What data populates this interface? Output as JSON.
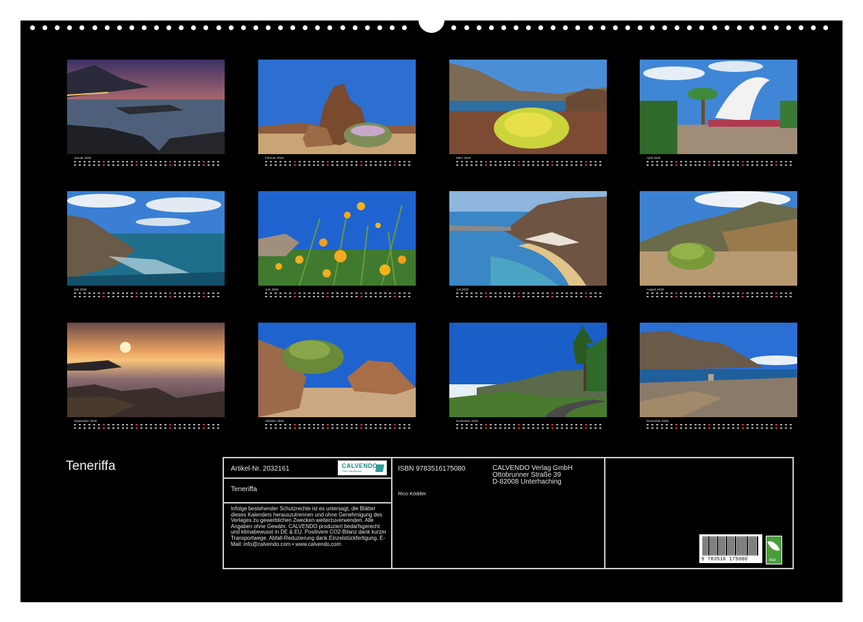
{
  "calendar": {
    "title": "Teneriffa",
    "months": [
      {
        "label": "Januar 2026",
        "scene": "coast-dusk"
      },
      {
        "label": "Februar 2026",
        "scene": "rock-desert"
      },
      {
        "label": "März 2026",
        "scene": "yellow-flowers-coast"
      },
      {
        "label": "April 2026",
        "scene": "auditorium-palms"
      },
      {
        "label": "Mai 2026",
        "scene": "rocky-ocean"
      },
      {
        "label": "Juni 2026",
        "scene": "poppies"
      },
      {
        "label": "Juli 2026",
        "scene": "beach-bay"
      },
      {
        "label": "August 2026",
        "scene": "mountain-shrub"
      },
      {
        "label": "September 2026",
        "scene": "sunset-sea"
      },
      {
        "label": "Oktober 2026",
        "scene": "boulders-shrub"
      },
      {
        "label": "November 2026",
        "scene": "mountain-road"
      },
      {
        "label": "Dezember 2026",
        "scene": "cliff-promenade"
      }
    ]
  },
  "info": {
    "article_no": "Artikel-Nr. 2032161",
    "logo_text": "CALVENDO",
    "logo_sub": "Gute Kalendertage",
    "title": "Teneriffa",
    "isbn": "ISBN 9783516175080",
    "author": "Rico Ködder",
    "publisher_name": "CALVENDO Verlag GmbH",
    "publisher_street": "Ottobrunner Straße 39",
    "publisher_city": "D-82008 Unterhaching",
    "legal_text": "Infolge bestehender Schutzrechte ist es untersagt, die Blätter dieses Kalenders herauszutrennen und ohne Genehmigung des Verlages zu gewerblichen Zwecken weiterzuverwenden. Alle Angaben ohne Gewähr. CALVENDO produziert bedarfsgerecht und klimabewusst in DE & EU. Positivere CO2-Bilanz dank kurzer Transportwege. Abfall-Reduzierung dank Einzelstückfertigung. E-Mail: info@calvendo.com • www.calvendo.com",
    "barcode_digits": "9 783516 175080",
    "eco_label": "eco"
  },
  "colors": {
    "background": "#000000",
    "text": "#e6e6e6",
    "frame": "#cfcfcf",
    "brand": "#1a8a8a",
    "eco": "#4a9e3a"
  }
}
